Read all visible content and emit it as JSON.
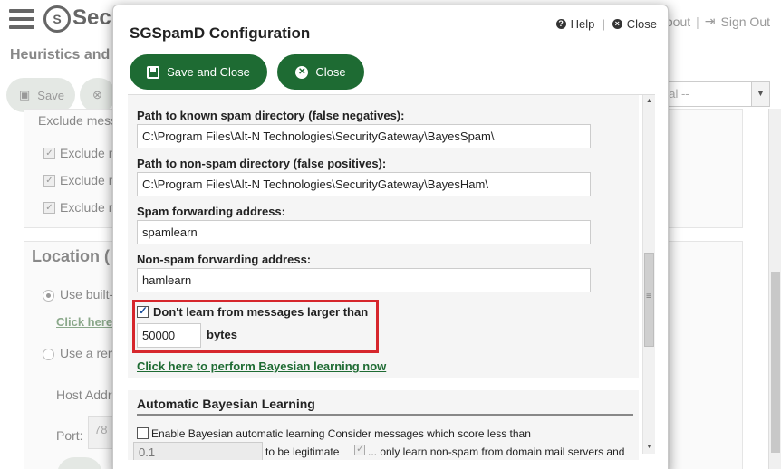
{
  "background": {
    "brand": "Sec",
    "page_title": "Heuristics and",
    "links": {
      "about": "bout",
      "signout": "Sign Out"
    },
    "toolbar": {
      "save_label": "Save"
    },
    "select_value": "bal --",
    "panel": {
      "exclude_header": "Exclude mess",
      "exclude_items": [
        "Exclude n",
        "Exclude n",
        "Exclude n"
      ]
    },
    "location": {
      "title": "Location (",
      "use_builtin": "Use built-",
      "click_here": "Click here",
      "use_remote": "Use a rem",
      "host_addr": "Host Addr",
      "port_label": "Port:",
      "port_value": "78"
    }
  },
  "modal": {
    "title": "SGSpamD Configuration",
    "help_label": "Help",
    "close_link": "Close",
    "save_close_label": "Save and Close",
    "close_button": "Close",
    "spam_dir_label": "Path to known spam directory (false negatives):",
    "spam_dir_value": "C:\\Program Files\\Alt-N Technologies\\SecurityGateway\\BayesSpam\\",
    "ham_dir_label": "Path to non-spam directory (false positives):",
    "ham_dir_value": "C:\\Program Files\\Alt-N Technologies\\SecurityGateway\\BayesHam\\",
    "spam_fwd_label": "Spam forwarding address:",
    "spam_fwd_value": "spamlearn",
    "ham_fwd_label": "Non-spam forwarding address:",
    "ham_fwd_value": "hamlearn",
    "size_limit_label": "Don't learn from messages larger than",
    "size_limit_checked": true,
    "size_limit_value": "50000",
    "bytes_label": "bytes",
    "learn_link": "Click here to perform Bayesian learning now",
    "auto_section_title": "Automatic Bayesian Learning",
    "auto_enable_label": "Enable Bayesian automatic learning Consider messages which score less than",
    "auto_score_value": "0.1",
    "legit_label": "to be legitimate",
    "only_learn_label": "... only learn non-spam from domain mail servers and"
  },
  "colors": {
    "accent": "#1e6b33",
    "highlight": "#d6262c"
  }
}
